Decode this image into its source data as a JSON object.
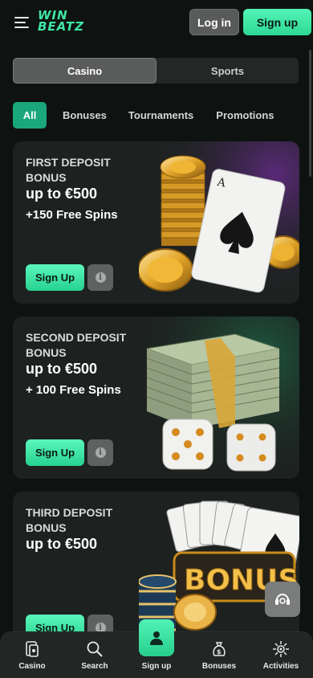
{
  "header": {
    "logo_line1": "WIN",
    "logo_line2": "BEATZ",
    "login_label": "Log in",
    "signup_label": "Sign up"
  },
  "segment": {
    "tabs": [
      {
        "label": "Casino",
        "active": true
      },
      {
        "label": "Sports",
        "active": false
      }
    ]
  },
  "filters": [
    {
      "label": "All",
      "active": true
    },
    {
      "label": "Bonuses",
      "active": false
    },
    {
      "label": "Tournaments",
      "active": false
    },
    {
      "label": "Promotions",
      "active": false
    }
  ],
  "cards": [
    {
      "title_line1": "FIRST DEPOSIT",
      "title_line2": "BONUS",
      "amount": "up to €500",
      "spins": "+150 Free Spins",
      "button": "Sign Up",
      "info": "i",
      "art": "coins-and-ace-card"
    },
    {
      "title_line1": "SECOND DEPOSIT",
      "title_line2": "BONUS",
      "amount": "up to €500",
      "spins": "+ 100 Free Spins",
      "button": "Sign Up",
      "info": "i",
      "art": "cash-stack-and-dice"
    },
    {
      "title_line1": "THIRD DEPOSIT",
      "title_line2": "BONUS",
      "amount": "up to €500",
      "spins": "",
      "button": "Sign Up",
      "info": "i",
      "art": "cards-chips-bonus-sign",
      "art_text": "BONUS"
    }
  ],
  "bottom_nav": [
    {
      "label": "Casino",
      "icon": "casino-icon"
    },
    {
      "label": "Search",
      "icon": "search-icon"
    },
    {
      "label": "Sign up",
      "icon": "user-icon"
    },
    {
      "label": "Bonuses",
      "icon": "money-bag-icon"
    },
    {
      "label": "Activities",
      "icon": "activities-icon"
    }
  ],
  "colors": {
    "accent": "#3ee6a3",
    "background": "#0e1311",
    "card": "#1d2220"
  }
}
